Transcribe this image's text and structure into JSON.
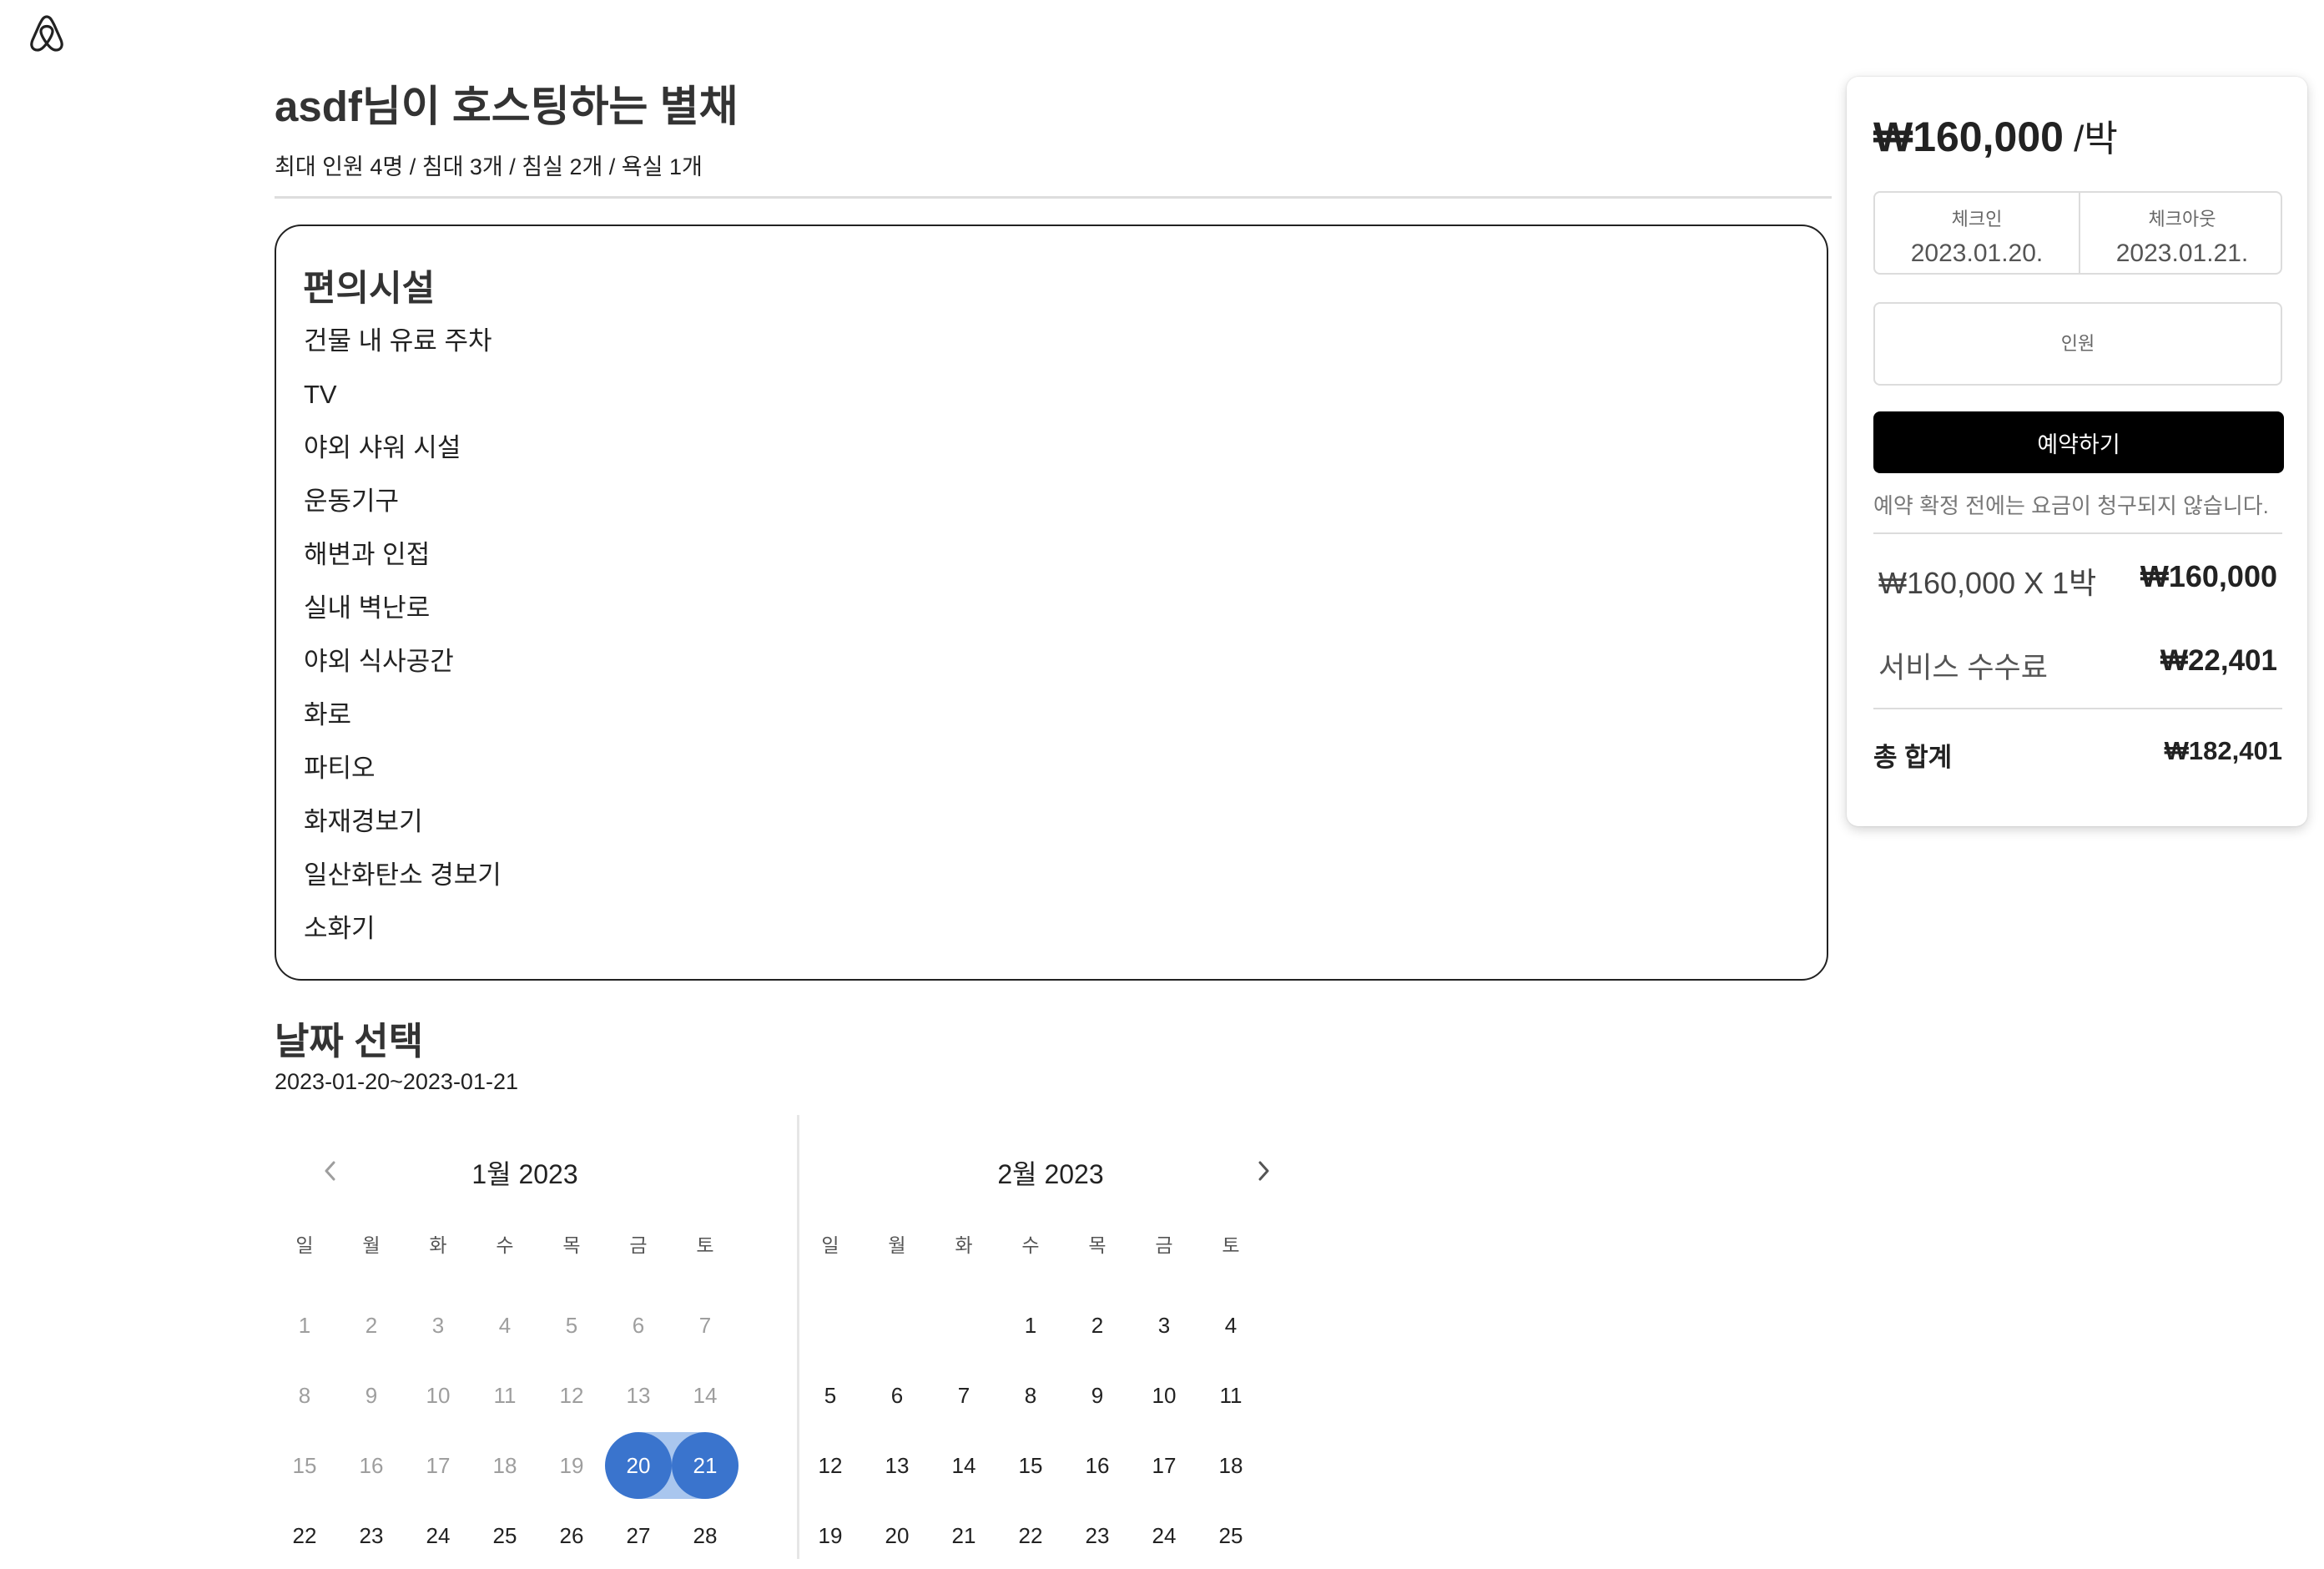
{
  "brand": {
    "logo_icon": "airbnb-logo-icon",
    "accent": "#3a74cd"
  },
  "listing": {
    "title": "asdf님이 호스팅하는 별채",
    "subtitle": "최대 인원 4명 / 침대 3개 / 침실 2개 / 욕실 1개"
  },
  "amenities": {
    "heading": "편의시설",
    "items": [
      "건물 내 유료 주차",
      "TV",
      "야외 샤워 시설",
      "운동기구",
      "해변과 인접",
      "실내 벽난로",
      "야외 식사공간",
      "화로",
      "파티오",
      "화재경보기",
      "일산화탄소 경보기",
      "소화기"
    ]
  },
  "date_select": {
    "heading": "날짜 선택",
    "range": "2023-01-20~2023-01-21"
  },
  "calendar": {
    "weekdays": [
      "일",
      "월",
      "화",
      "수",
      "목",
      "금",
      "토"
    ],
    "months": [
      {
        "title": "1월 2023",
        "first_weekday": 0,
        "visible_days": 28,
        "past_until": 19,
        "selected": [
          20,
          21
        ]
      },
      {
        "title": "2월 2023",
        "first_weekday": 3,
        "visible_days": 25,
        "past_until": 0,
        "selected": []
      }
    ],
    "prev_icon": "chevron-left-icon",
    "next_icon": "chevron-right-icon"
  },
  "booking": {
    "price": "₩160,000",
    "per_night": " /박",
    "checkin_label": "체크인",
    "checkin_value": "2023.01.20.",
    "checkout_label": "체크아웃",
    "checkout_value": "2023.01.21.",
    "guests_label": "인원",
    "reserve_label": "예약하기",
    "notice": "예약 확정 전에는 요금이 청구되지 않습니다.",
    "nightly_label": "₩160,000 X 1박",
    "nightly_total": "₩160,000",
    "service_fee_label": "서비스 수수료",
    "service_fee": "₩22,401",
    "total_label": "총 합계",
    "total": "₩182,401"
  }
}
